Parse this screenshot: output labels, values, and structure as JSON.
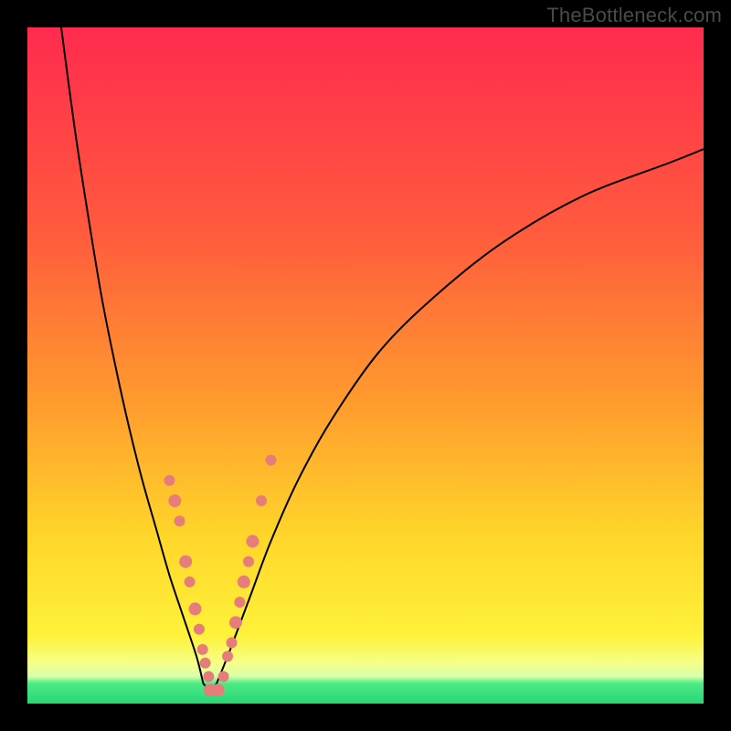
{
  "watermark": "TheBottleneck.com",
  "colors": {
    "top": "#ff2b4e",
    "upper": "#ff5a3e",
    "mid": "#ff9a2e",
    "lowmid": "#ffd52a",
    "yellow": "#fff23a",
    "pale": "#f6ff8a",
    "pale2": "#d8ffab",
    "green": "#4deb85",
    "green2": "#28d676"
  },
  "chart_data": {
    "type": "line",
    "title": "",
    "xlabel": "",
    "ylabel": "",
    "xlim": [
      0,
      100
    ],
    "ylim": [
      0,
      100
    ],
    "series": [
      {
        "name": "left-branch",
        "x": [
          5,
          7,
          9,
          11,
          13,
          15,
          17,
          19,
          21,
          23,
          25,
          26
        ],
        "y": [
          100,
          85,
          72,
          60,
          50,
          41,
          33,
          26,
          19,
          13,
          7,
          3
        ]
      },
      {
        "name": "right-branch",
        "x": [
          28,
          30,
          33,
          36,
          40,
          45,
          52,
          60,
          70,
          82,
          95,
          100
        ],
        "y": [
          3,
          8,
          16,
          24,
          33,
          42,
          52,
          60,
          68,
          75,
          80,
          82
        ]
      }
    ],
    "floor_band": {
      "y0": 0,
      "y1": 4
    },
    "markers": [
      {
        "x": 21.0,
        "y": 33,
        "r": 6
      },
      {
        "x": 21.8,
        "y": 30,
        "r": 7
      },
      {
        "x": 22.5,
        "y": 27,
        "r": 6
      },
      {
        "x": 23.4,
        "y": 21,
        "r": 7
      },
      {
        "x": 24.0,
        "y": 18,
        "r": 6
      },
      {
        "x": 24.8,
        "y": 14,
        "r": 7
      },
      {
        "x": 25.4,
        "y": 11,
        "r": 6
      },
      {
        "x": 25.9,
        "y": 8,
        "r": 6
      },
      {
        "x": 26.3,
        "y": 6,
        "r": 6
      },
      {
        "x": 26.8,
        "y": 4,
        "r": 6
      },
      {
        "x": 27.0,
        "y": 2,
        "r": 7
      },
      {
        "x": 28.2,
        "y": 2,
        "r": 7
      },
      {
        "x": 29.0,
        "y": 4,
        "r": 6
      },
      {
        "x": 29.6,
        "y": 7,
        "r": 6
      },
      {
        "x": 30.2,
        "y": 9,
        "r": 6
      },
      {
        "x": 30.8,
        "y": 12,
        "r": 7
      },
      {
        "x": 31.4,
        "y": 15,
        "r": 6
      },
      {
        "x": 32.0,
        "y": 18,
        "r": 7
      },
      {
        "x": 32.7,
        "y": 21,
        "r": 6
      },
      {
        "x": 33.3,
        "y": 24,
        "r": 7
      },
      {
        "x": 34.6,
        "y": 30,
        "r": 6
      },
      {
        "x": 36.0,
        "y": 36,
        "r": 6
      }
    ]
  }
}
